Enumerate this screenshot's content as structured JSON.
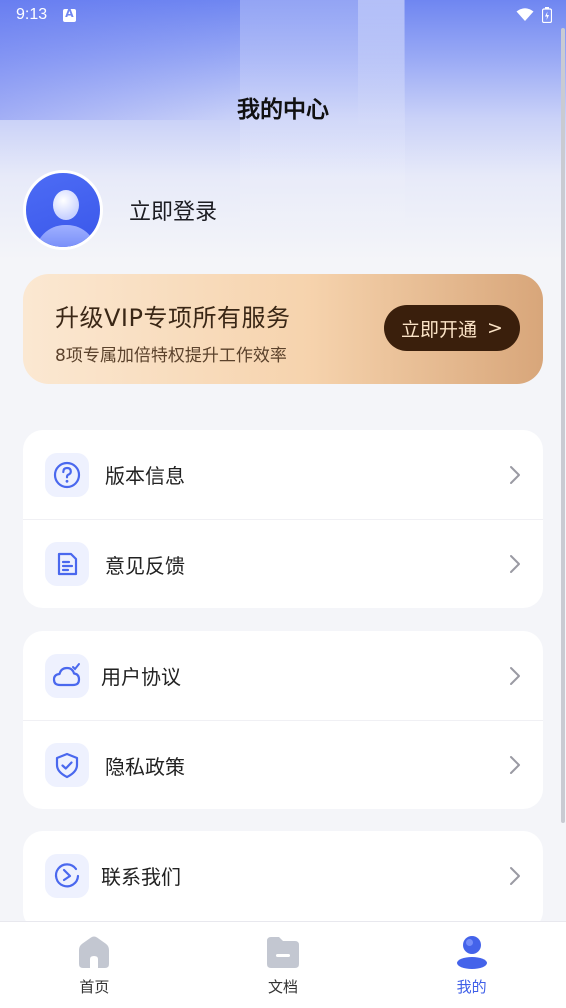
{
  "status_bar": {
    "time": "9:13"
  },
  "header": {
    "title": "我的中心"
  },
  "profile": {
    "login_label": "立即登录"
  },
  "vip": {
    "title": "升级VIP专项所有服务",
    "subtitle": "8项专属加倍特权提升工作效率",
    "button_label": "立即开通",
    "button_arrow": ">"
  },
  "menu_groups": [
    {
      "items": [
        {
          "label": "版本信息",
          "icon": "question-icon"
        },
        {
          "label": "意见反馈",
          "icon": "feedback-icon"
        }
      ]
    },
    {
      "items": [
        {
          "label": "用户协议",
          "icon": "cloud-icon"
        },
        {
          "label": "隐私政策",
          "icon": "shield-icon"
        }
      ]
    },
    {
      "items": [
        {
          "label": "联系我们",
          "icon": "contact-icon"
        }
      ]
    }
  ],
  "bottom_nav": {
    "items": [
      {
        "label": "首页",
        "icon": "home-icon",
        "active": false
      },
      {
        "label": "文档",
        "icon": "folder-icon",
        "active": false
      },
      {
        "label": "我的",
        "icon": "user-icon",
        "active": true
      }
    ]
  },
  "colors": {
    "accent": "#3f5fe8",
    "vip_button": "#3a1f0c"
  }
}
